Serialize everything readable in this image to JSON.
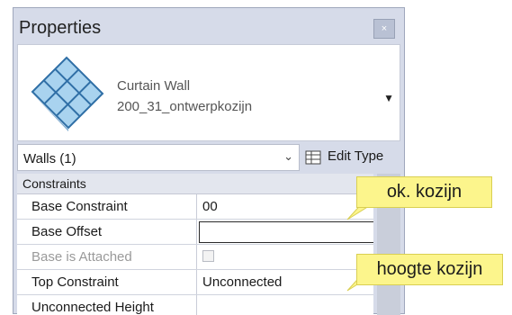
{
  "panel": {
    "title": "Properties",
    "close_glyph": "×"
  },
  "type_selector": {
    "family": "Curtain Wall",
    "type": "200_31_ontwerpkozijn",
    "thumbnail_icon": "curtain-wall-icon",
    "dropdown_glyph": "▼"
  },
  "instance": {
    "label": "Walls (1)",
    "chevron_glyph": "⌄",
    "edit_type_label": "Edit Type",
    "edit_type_icon": "edit-type-icon"
  },
  "section": {
    "label": "Constraints"
  },
  "properties": [
    {
      "name": "Base Constraint",
      "value": "00"
    },
    {
      "name": "Base Offset",
      "value": ""
    },
    {
      "name": "Base is Attached",
      "value": ""
    },
    {
      "name": "Top Constraint",
      "value": "Unconnected"
    },
    {
      "name": "Unconnected Height",
      "value": ""
    }
  ],
  "callouts": [
    {
      "text": "ok. kozijn"
    },
    {
      "text": "hoogte kozijn"
    }
  ],
  "colors": {
    "panel_bg": "#d6dbe9",
    "callout_bg": "#fcf58c",
    "thumbnail_glass": "#a9d3ef"
  }
}
